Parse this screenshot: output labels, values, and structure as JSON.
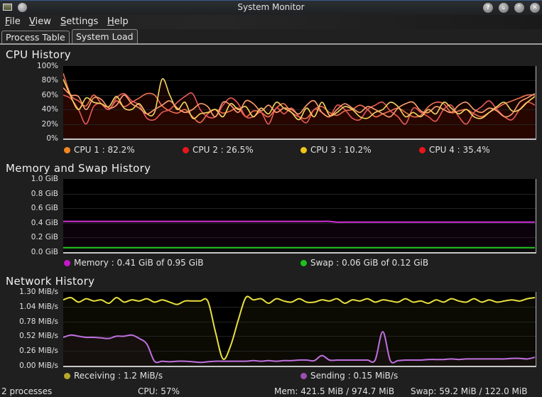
{
  "window": {
    "title": "System Monitor",
    "buttons": [
      {
        "name": "help-button",
        "icon": "question-icon",
        "glyph": "?"
      },
      {
        "name": "minimize-button",
        "icon": "chevron-down-icon",
        "glyph": "⌄"
      },
      {
        "name": "maximize-button",
        "icon": "chevron-up-icon",
        "glyph": "⌃"
      },
      {
        "name": "close-button",
        "icon": "close-icon",
        "glyph": "✕"
      }
    ]
  },
  "menu": [
    {
      "mnemonic": "F",
      "rest": "ile"
    },
    {
      "mnemonic": "V",
      "rest": "iew"
    },
    {
      "mnemonic": "S",
      "rest": "ettings"
    },
    {
      "mnemonic": "H",
      "rest": "elp"
    }
  ],
  "tabs": [
    {
      "label": "Process Table",
      "active": false
    },
    {
      "label": "System Load",
      "active": true
    }
  ],
  "cpu": {
    "title": "CPU History",
    "y_ticks": [
      "100%",
      "80%",
      "60%",
      "40%",
      "20%",
      "0%"
    ],
    "legend": [
      {
        "label": "CPU 1 : 82.2%",
        "color": "#f5861f"
      },
      {
        "label": "CPU 2 : 26.5%",
        "color": "#e8161a"
      },
      {
        "label": "CPU 3 : 10.2%",
        "color": "#f0c419"
      },
      {
        "label": "CPU 4 : 35.4%",
        "color": "#e8161a"
      }
    ]
  },
  "memory": {
    "title": "Memory and Swap History",
    "y_ticks": [
      "1.0 GiB",
      "0.8 GiB",
      "0.6 GiB",
      "0.4 GiB",
      "0.2 GiB",
      "0.0 GiB"
    ],
    "legend": [
      {
        "label": "Memory : 0.41 GiB of 0.95 GiB",
        "color": "#c418c8"
      },
      {
        "label": "Swap : 0.06 GiB of 0.12 GiB",
        "color": "#1cc21c"
      }
    ]
  },
  "network": {
    "title": "Network History",
    "y_ticks": [
      "1.30 MiB/s",
      "1.04 MiB/s",
      "0.78 MiB/s",
      "0.52 MiB/s",
      "0.26 MiB/s",
      "0.00 MiB/s"
    ],
    "legend": [
      {
        "label": "Receiving : 1.2 MiB/s",
        "color": "#b8a82a"
      },
      {
        "label": "Sending : 0.15 MiB/s",
        "color": "#9a4fb0"
      }
    ]
  },
  "status": {
    "processes": "2 processes",
    "cpu": "CPU: 57%",
    "mem": "Mem: 421.5 MiB / 974.7 MiB",
    "swap": "Swap: 59.2 MiB / 122.0 MiB"
  },
  "chart_data": [
    {
      "type": "line",
      "title": "CPU History",
      "ylabel": "",
      "ylim": [
        0,
        100
      ],
      "y_unit": "%",
      "grid": true,
      "legend_position": "bottom",
      "series": [
        {
          "name": "CPU 1",
          "color": "#f07050",
          "values": [
            90,
            60,
            52,
            45,
            60,
            48,
            40,
            52,
            44,
            50,
            56,
            62,
            60,
            45,
            38,
            35,
            40,
            30,
            22,
            34,
            40,
            35,
            38,
            42,
            30,
            38,
            36,
            30,
            42,
            48,
            36,
            30,
            28,
            40,
            44,
            36,
            32,
            38,
            40,
            46,
            40,
            30,
            34,
            38,
            42,
            36,
            30,
            32,
            44,
            50,
            48,
            36,
            38,
            40,
            34,
            30,
            36,
            42,
            48,
            52,
            56,
            60,
            60
          ]
        },
        {
          "name": "CPU 2",
          "color": "#e85a5a",
          "values": [
            60,
            55,
            40,
            20,
            44,
            48,
            40,
            56,
            62,
            52,
            46,
            28,
            26,
            36,
            40,
            50,
            58,
            62,
            40,
            30,
            30,
            46,
            56,
            48,
            30,
            30,
            36,
            20,
            42,
            34,
            42,
            30,
            22,
            40,
            36,
            30,
            46,
            40,
            28,
            26,
            40,
            46,
            50,
            38,
            30,
            20,
            42,
            36,
            30,
            24,
            40,
            46,
            30,
            20,
            36,
            44,
            52,
            40,
            30,
            26,
            40,
            50,
            46
          ]
        },
        {
          "name": "CPU 3",
          "color": "#f2d860",
          "values": [
            82,
            58,
            40,
            56,
            50,
            48,
            44,
            58,
            42,
            40,
            48,
            34,
            36,
            82,
            60,
            40,
            50,
            28,
            34,
            36,
            40,
            30,
            48,
            40,
            44,
            30,
            42,
            34,
            50,
            42,
            36,
            26,
            42,
            30,
            50,
            32,
            36,
            44,
            40,
            30,
            28,
            36,
            40,
            50,
            44,
            30,
            36,
            30,
            40,
            34,
            50,
            42,
            34,
            40,
            30,
            28,
            36,
            44,
            50,
            38,
            40,
            50,
            58
          ]
        },
        {
          "name": "CPU 4",
          "color": "#ffa070",
          "values": [
            70,
            60,
            58,
            40,
            56,
            54,
            42,
            46,
            60,
            48,
            42,
            34,
            40,
            46,
            52,
            42,
            36,
            40,
            48,
            44,
            30,
            50,
            46,
            36,
            52,
            48,
            38,
            46,
            36,
            42,
            40,
            34,
            46,
            52,
            36,
            30,
            40,
            48,
            42,
            36,
            44,
            40,
            34,
            30,
            42,
            48,
            50,
            38,
            36,
            44,
            40,
            36,
            46,
            50,
            40,
            36,
            42,
            38,
            30,
            34,
            50,
            56,
            62
          ]
        }
      ]
    },
    {
      "type": "line",
      "title": "Memory and Swap History",
      "ylabel": "",
      "ylim": [
        0,
        1.0
      ],
      "y_unit": "GiB",
      "grid": true,
      "legend_position": "bottom",
      "series": [
        {
          "name": "Memory",
          "color": "#d030d8",
          "values": [
            0.42,
            0.42,
            0.42,
            0.42,
            0.42,
            0.42,
            0.42,
            0.42,
            0.42,
            0.42,
            0.42,
            0.42,
            0.42,
            0.42,
            0.42,
            0.42,
            0.42,
            0.42,
            0.42,
            0.42,
            0.42,
            0.42,
            0.42,
            0.42,
            0.42,
            0.42,
            0.42,
            0.42,
            0.42,
            0.42,
            0.42,
            0.42,
            0.42,
            0.42,
            0.42,
            0.42,
            0.41,
            0.41,
            0.41,
            0.41,
            0.41,
            0.41,
            0.41,
            0.41,
            0.41,
            0.41,
            0.41,
            0.41,
            0.41,
            0.41,
            0.41,
            0.41,
            0.41,
            0.41,
            0.41,
            0.41,
            0.41,
            0.41,
            0.41,
            0.41,
            0.41,
            0.41,
            0.41
          ]
        },
        {
          "name": "Swap",
          "color": "#22c822",
          "values": [
            0.06,
            0.06,
            0.06,
            0.06,
            0.06,
            0.06,
            0.06,
            0.06,
            0.06,
            0.06,
            0.06,
            0.06,
            0.06,
            0.06,
            0.06,
            0.06,
            0.06,
            0.06,
            0.06,
            0.06,
            0.06,
            0.06,
            0.06,
            0.06,
            0.06,
            0.06,
            0.06,
            0.06,
            0.06,
            0.06,
            0.06,
            0.06,
            0.06,
            0.06,
            0.06,
            0.06,
            0.06,
            0.06,
            0.06,
            0.06,
            0.06,
            0.06,
            0.06,
            0.06,
            0.06,
            0.06,
            0.06,
            0.06,
            0.06,
            0.06,
            0.06,
            0.06,
            0.06,
            0.06,
            0.06,
            0.06,
            0.06,
            0.06,
            0.06,
            0.06,
            0.06,
            0.06,
            0.06
          ]
        }
      ]
    },
    {
      "type": "line",
      "title": "Network History",
      "ylabel": "",
      "ylim": [
        0,
        1.3
      ],
      "y_unit": "MiB/s",
      "grid": true,
      "legend_position": "bottom",
      "series": [
        {
          "name": "Receiving",
          "color": "#e8e040",
          "values": [
            1.16,
            1.2,
            1.12,
            1.18,
            1.14,
            1.16,
            1.1,
            1.2,
            1.12,
            1.16,
            1.14,
            1.18,
            1.12,
            1.16,
            1.12,
            1.08,
            1.14,
            1.14,
            1.14,
            1.14,
            0.6,
            0.12,
            0.35,
            0.8,
            1.2,
            1.16,
            1.18,
            1.1,
            1.18,
            1.14,
            1.12,
            1.18,
            1.12,
            1.12,
            1.16,
            1.14,
            1.18,
            1.1,
            1.16,
            1.14,
            1.18,
            1.12,
            1.16,
            1.14,
            1.12,
            1.18,
            1.12,
            1.14,
            1.1,
            1.16,
            1.12,
            1.18,
            1.14,
            1.12,
            1.18,
            1.12,
            1.16,
            1.12,
            1.14,
            1.16,
            1.14,
            1.18,
            1.2
          ]
        },
        {
          "name": "Sending",
          "color": "#c070e0",
          "values": [
            0.5,
            0.54,
            0.52,
            0.5,
            0.5,
            0.49,
            0.48,
            0.52,
            0.52,
            0.54,
            0.48,
            0.38,
            0.08,
            0.08,
            0.07,
            0.08,
            0.08,
            0.07,
            0.06,
            0.07,
            0.08,
            0.08,
            0.08,
            0.08,
            0.08,
            0.09,
            0.08,
            0.09,
            0.08,
            0.09,
            0.09,
            0.1,
            0.1,
            0.09,
            0.18,
            0.1,
            0.1,
            0.1,
            0.1,
            0.1,
            0.1,
            0.1,
            0.6,
            0.09,
            0.09,
            0.1,
            0.1,
            0.1,
            0.11,
            0.11,
            0.11,
            0.12,
            0.11,
            0.12,
            0.12,
            0.12,
            0.12,
            0.12,
            0.12,
            0.13,
            0.13,
            0.12,
            0.15
          ]
        }
      ]
    }
  ]
}
